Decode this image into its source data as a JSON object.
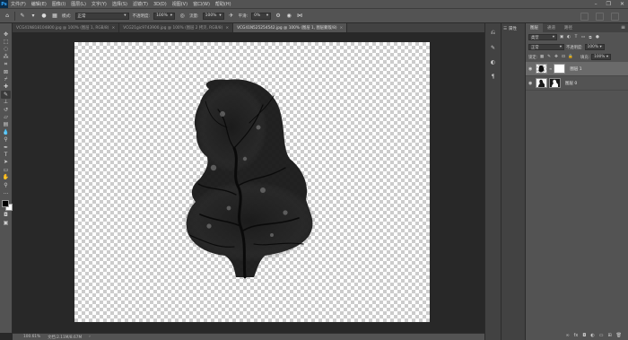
{
  "app": {
    "logo": "Ps"
  },
  "menu": [
    "文件(F)",
    "编辑(E)",
    "图像(I)",
    "图层(L)",
    "文字(Y)",
    "选择(S)",
    "滤镜(T)",
    "3D(D)",
    "视图(V)",
    "窗口(W)",
    "帮助(H)"
  ],
  "window_controls": [
    "–",
    "❐",
    "✕"
  ],
  "options": {
    "mode_label": "模式:",
    "mode_value": "正常",
    "opacity_label": "不透明度:",
    "opacity_value": "100%",
    "flow_label": "流量:",
    "flow_value": "100%",
    "smooth_label": "平滑:",
    "smooth_value": "0%"
  },
  "tabs": [
    {
      "label": "VCG41N818104800.jpg @ 100% (图层 1, RGB/8)",
      "active": false
    },
    {
      "label": "VCG21gic9743900.jpg @ 100% (图层 2 拷贝, RGB/8)",
      "active": false
    },
    {
      "label": "VCG41N525254542.jpg @ 100% (图层 1, 图层蒙版/8)",
      "active": true
    }
  ],
  "status": {
    "zoom": "100.61%",
    "doc": "文档:2.11M/8.67M"
  },
  "properties": {
    "label": "属性"
  },
  "layers_panel": {
    "tabs": [
      "图层",
      "通道",
      "路径"
    ],
    "kind_label": "类型",
    "blend_mode": "正常",
    "opacity_label": "不透明度:",
    "opacity_value": "100%",
    "lock_label": "锁定:",
    "fill_label": "填充:",
    "fill_value": "100%",
    "layers": [
      {
        "name": "图层 1",
        "selected": true
      },
      {
        "name": "图层 0",
        "selected": false
      }
    ]
  },
  "colors": {
    "foreground": "#000000",
    "background": "#ffffff",
    "accent": "#31a8ff"
  }
}
